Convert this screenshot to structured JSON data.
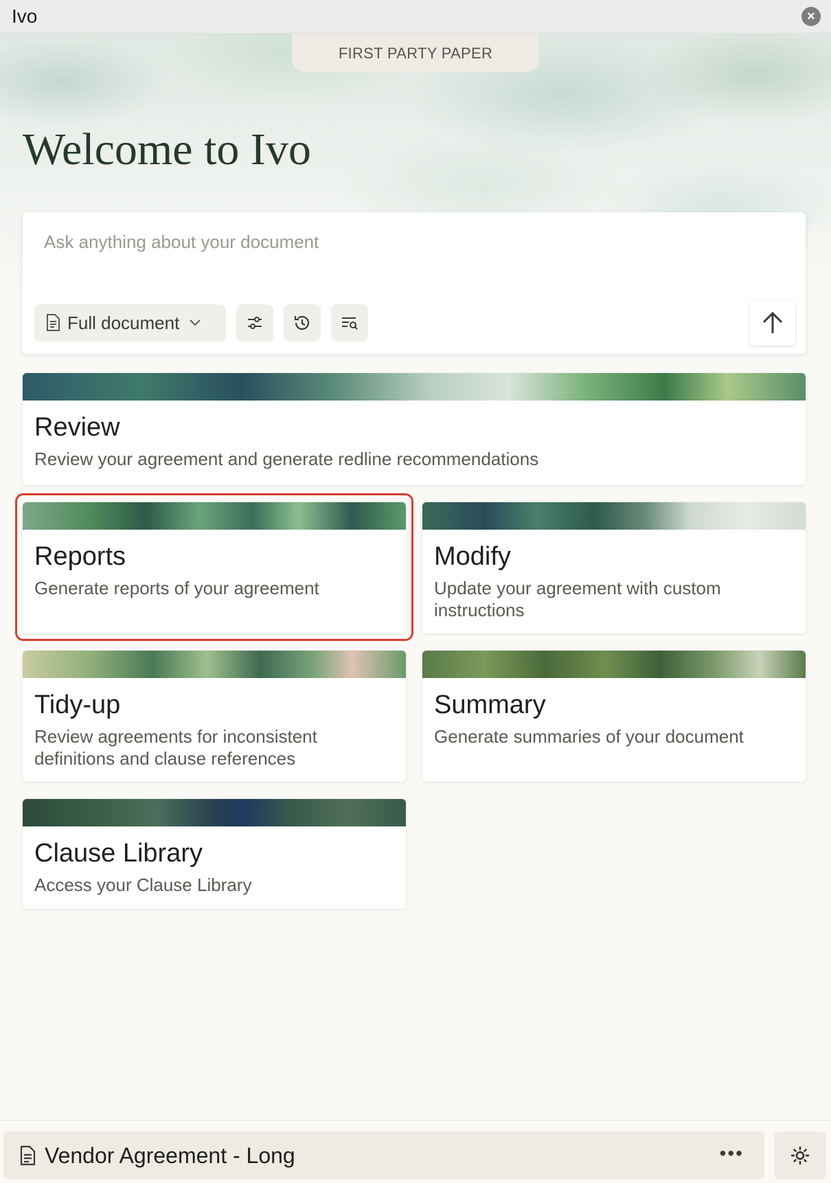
{
  "window": {
    "title": "Ivo",
    "close_icon": "close-icon"
  },
  "header": {
    "pill_label": "FIRST PARTY PAPER",
    "welcome": "Welcome to Ivo"
  },
  "ask": {
    "placeholder": "Ask anything about your document",
    "scope_label": "Full document",
    "icons": [
      "document-icon",
      "chevron-down-icon",
      "sliders-icon",
      "history-icon",
      "search-list-icon",
      "arrow-up-icon"
    ]
  },
  "cards": {
    "review": {
      "title": "Review",
      "desc": "Review your agreement and generate redline recommendations"
    },
    "reports": {
      "title": "Reports",
      "desc": "Generate reports of your agreement"
    },
    "modify": {
      "title": "Modify",
      "desc": "Update your agreement with custom instructions"
    },
    "tidy": {
      "title": "Tidy-up",
      "desc": "Review agreements for inconsistent definitions and clause references"
    },
    "summary": {
      "title": "Summary",
      "desc": "Generate summaries of your document"
    },
    "clause": {
      "title": "Clause Library",
      "desc": "Access your Clause Library"
    }
  },
  "footer": {
    "document_name": "Vendor Agreement - Long",
    "more_label": "•••",
    "settings_icon": "gear-icon"
  },
  "colors": {
    "highlight": "#d6402f",
    "heading": "#27392f"
  }
}
